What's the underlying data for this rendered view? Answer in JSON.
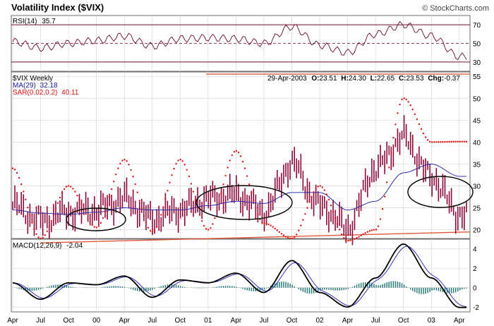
{
  "header": {
    "title": "Volatility Index ($VIX)",
    "credit": "© StockCharts.com"
  },
  "rsi_panel": {
    "label": "RSI(14)",
    "value": "35.7",
    "ticks": [
      "70",
      "50",
      "30"
    ]
  },
  "price_panel": {
    "symbol_label": "$VIX Weekly",
    "ma_label": "MA(29)",
    "ma_value": "32.18",
    "sar_label": "SAR(0.02,0.2)",
    "sar_value": "40.11",
    "ohlc": {
      "date": "29-Apr-2003",
      "open_label": "O:",
      "open": "23.51",
      "high_label": "H:",
      "high": "24.30",
      "low_label": "L:",
      "low": "22.65",
      "close_label": "C:",
      "close": "23.53",
      "chg_label": "Chg:",
      "chg": "-0.37"
    },
    "ticks": [
      "55",
      "50",
      "45",
      "40",
      "35",
      "30",
      "25",
      "20"
    ]
  },
  "macd_panel": {
    "label": "MACD(12,26,9)",
    "value": "-2.04",
    "ticks": [
      "4",
      "2",
      "0",
      "-2"
    ]
  },
  "x_axis": {
    "ticks": [
      "Apr",
      "Jul",
      "Oct",
      "00",
      "Apr",
      "Jul",
      "Oct",
      "01",
      "Apr",
      "Jul",
      "Oct",
      "02",
      "Apr",
      "Jul",
      "Oct",
      "03",
      "Apr"
    ]
  },
  "colors": {
    "price": "#8b0a3c",
    "ma": "#1a1aaa",
    "sar": "#e01010",
    "trendline": "#e05a3a",
    "rsi": "#6a0a30",
    "rsi_ref": "#7a0a30",
    "macd": "#000000",
    "signal": "#2020bb",
    "hist": "#2a7a7a",
    "ellipse": "#000000"
  },
  "chart_data": {
    "type": "line",
    "frequency": "weekly",
    "x_range": [
      "1999-04",
      "2003-04"
    ],
    "x": [
      "1999-04",
      "1999-07",
      "1999-10",
      "2000-01",
      "2000-04",
      "2000-07",
      "2000-10",
      "2001-01",
      "2001-04",
      "2001-07",
      "2001-10",
      "2002-01",
      "2002-04",
      "2002-07",
      "2002-10",
      "2003-01",
      "2003-04"
    ],
    "series": [
      {
        "name": "$VIX Weekly",
        "values": [
          25.5,
          22.0,
          24.0,
          24.5,
          27.0,
          22.5,
          24.5,
          27.0,
          28.0,
          24.0,
          35.0,
          25.5,
          20.5,
          34.0,
          41.0,
          32.0,
          23.53
        ]
      },
      {
        "name": "MA(29)",
        "values": [
          24.5,
          23.8,
          23.5,
          24.0,
          25.0,
          24.5,
          24.5,
          25.5,
          26.5,
          26.0,
          28.5,
          28.5,
          24.5,
          26.5,
          33.0,
          35.0,
          32.18
        ]
      },
      {
        "name": "SAR(0.02,0.2)",
        "values": [
          34.0,
          18.0,
          30.0,
          20.5,
          36.0,
          19.5,
          36.0,
          20.0,
          38.0,
          21.5,
          18.0,
          30.0,
          17.5,
          20.0,
          50.0,
          40.0,
          40.11
        ]
      },
      {
        "name": "RSI(14)",
        "values": [
          52,
          45,
          50,
          53,
          58,
          47,
          55,
          56,
          55,
          50,
          68,
          48,
          40,
          60,
          70,
          58,
          35.7
        ]
      },
      {
        "name": "MACD(12,26,9)",
        "values": [
          0.5,
          -1.2,
          0.5,
          0.3,
          1.2,
          -1.0,
          0.8,
          0.5,
          1.5,
          -0.5,
          2.8,
          -0.5,
          -2.0,
          1.0,
          4.5,
          1.0,
          -2.04
        ]
      }
    ],
    "price_ylim": [
      18,
      56
    ],
    "rsi_ylim": [
      20,
      80
    ],
    "macd_ylim": [
      -2.5,
      5
    ],
    "reference_levels": {
      "resistance": 55.5
    },
    "trendline": {
      "from": [
        "1999-07",
        17
      ],
      "to": [
        "2003-04",
        19.5
      ]
    },
    "annotations": [
      "ellipse near Oct 1999 lows",
      "ellipse near Apr-Jul 2001 lows",
      "ellipse near early 2003"
    ],
    "grid": true,
    "legend": "top-left"
  }
}
